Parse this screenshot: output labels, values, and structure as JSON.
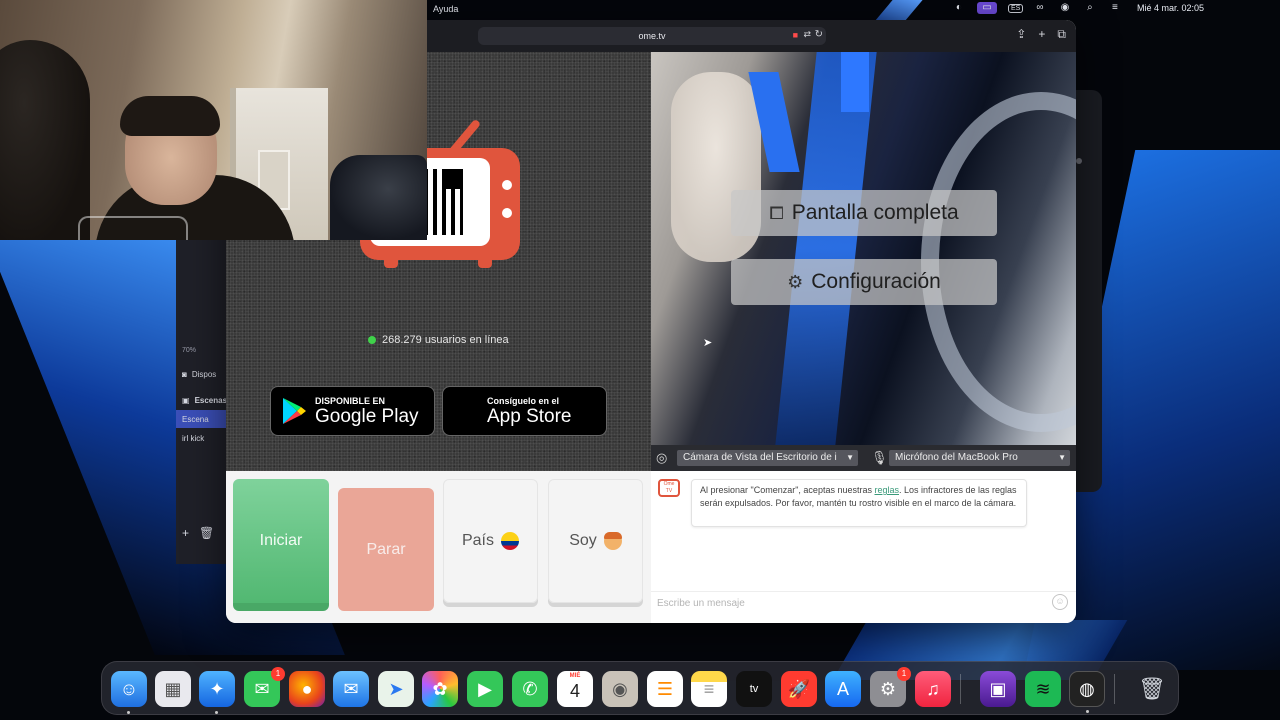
{
  "menubar": {
    "help_menu": "Ayuda",
    "input_source": "ES",
    "datetime": "Mié 4 mar.  02:05"
  },
  "browser": {
    "url": "ome.tv",
    "status": {
      "online_count": "268.279 usuarios en línea"
    },
    "stores": {
      "google_small": "DISPONIBLE EN",
      "google_big": "Google Play",
      "apple_small": "Consíguelo en el",
      "apple_big": "App Store"
    },
    "video_overlay": {
      "fullscreen_label": "Pantalla completa",
      "settings_label": "Configuración"
    },
    "devices": {
      "camera": "Cámara de Vista del Escritorio de i",
      "microphone": "Micrófono del MacBook Pro"
    },
    "controls": {
      "start": "Iniciar",
      "stop": "Parar",
      "country": "País",
      "gender": "Soy"
    },
    "chat": {
      "logo_text": "Ome TV",
      "message_before_link": "Al presionar \"Comenzar\", aceptas nuestras ",
      "message_link": "reglas",
      "message_after_link": ". Los infractores de las reglas serán expulsados. Por favor, mantén tu rostro visible en el marco de la cámara.",
      "input_placeholder": "Escribe un mensaje"
    }
  },
  "obs": {
    "zoom": "70%",
    "sources_label": "Dispos",
    "scenes_header": "Escenas",
    "scenes": [
      "Escena",
      "irl kick"
    ]
  },
  "dock": {
    "messages_badge": "1",
    "settings_badge": "1",
    "calendar_month": "MIÉ",
    "calendar_day": "4",
    "tv_label": "tv"
  },
  "colors": {
    "start_green": "#52b872",
    "stop_salmon": "#eaa697",
    "brand_orange": "#e0553d",
    "online_green": "#3fd24a",
    "record_red": "#ff4b4b"
  }
}
